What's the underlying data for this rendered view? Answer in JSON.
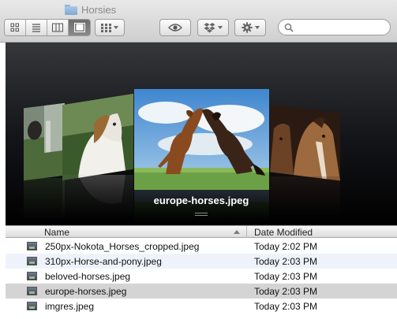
{
  "window": {
    "title": "Horsies"
  },
  "toolbar": {
    "views": [
      {
        "name": "icon-view",
        "icon": "icon-grid-icon"
      },
      {
        "name": "list-view",
        "icon": "list-lines-icon"
      },
      {
        "name": "column-view",
        "icon": "columns-icon"
      },
      {
        "name": "cover-flow-view",
        "icon": "coverflow-icon",
        "active": true
      }
    ],
    "arrange_icon": "arrange-grid-icon",
    "quicklook_icon": "eye-icon",
    "dropbox_icon": "dropbox-icon",
    "action_icon": "gear-icon",
    "search": {
      "value": "",
      "placeholder": ""
    }
  },
  "coverflow": {
    "caption": "europe-horses.jpeg",
    "colors": {
      "bg_top": "#35373b",
      "bg_bottom": "#000000"
    }
  },
  "list": {
    "columns": {
      "name": "Name",
      "date": "Date Modified"
    },
    "sort": "ascending",
    "rows": [
      {
        "name": "250px-Nokota_Horses_cropped.jpeg",
        "date": "Today 2:02 PM",
        "selected": false
      },
      {
        "name": "310px-Horse-and-pony.jpeg",
        "date": "Today 2:03 PM",
        "selected": false
      },
      {
        "name": "beloved-horses.jpeg",
        "date": "Today 2:03 PM",
        "selected": false
      },
      {
        "name": "europe-horses.jpeg",
        "date": "Today 2:03 PM",
        "selected": true
      },
      {
        "name": "imgres.jpeg",
        "date": "Today 2:03 PM",
        "selected": false
      }
    ]
  },
  "colors": {
    "selection": "#d4d4d4",
    "alternate_row": "#eef3fb",
    "toolbar_top": "#e8e8e8",
    "toolbar_bottom": "#cfcfcf"
  }
}
